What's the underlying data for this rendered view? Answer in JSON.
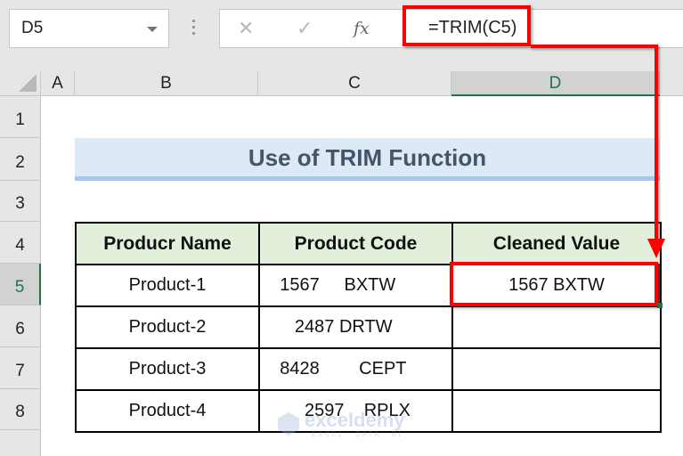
{
  "name_box": {
    "value": "D5"
  },
  "formula_bar": {
    "cancel_icon": "✕",
    "enter_icon": "✓",
    "fx_label": "fx",
    "formula": "=TRIM(C5)"
  },
  "columns": [
    "A",
    "B",
    "C",
    "D"
  ],
  "selected_column": "D",
  "rows": [
    "1",
    "2",
    "3",
    "4",
    "5",
    "6",
    "7",
    "8"
  ],
  "selected_row": "5",
  "sheet": {
    "title": "Use of TRIM Function",
    "table": {
      "headers": [
        "Producr Name",
        "Product Code",
        "Cleaned Value"
      ],
      "rows": [
        {
          "name": "Product-1",
          "code": "    1567     BXTW",
          "clean": "1567 BXTW"
        },
        {
          "name": "Product-2",
          "code": "       2487 DRTW",
          "clean": ""
        },
        {
          "name": "Product-3",
          "code": "    8428        CEPT",
          "clean": ""
        },
        {
          "name": "Product-4",
          "code": "         2597    RPLX",
          "clean": ""
        }
      ]
    }
  },
  "watermark": {
    "brand": "exceldemy",
    "tagline": "EXCEL · DATA · BI"
  },
  "colors": {
    "highlight": "#ff0000",
    "selection": "#217346",
    "header_fill": "#e2efda",
    "title_fill": "#dde9f5"
  }
}
